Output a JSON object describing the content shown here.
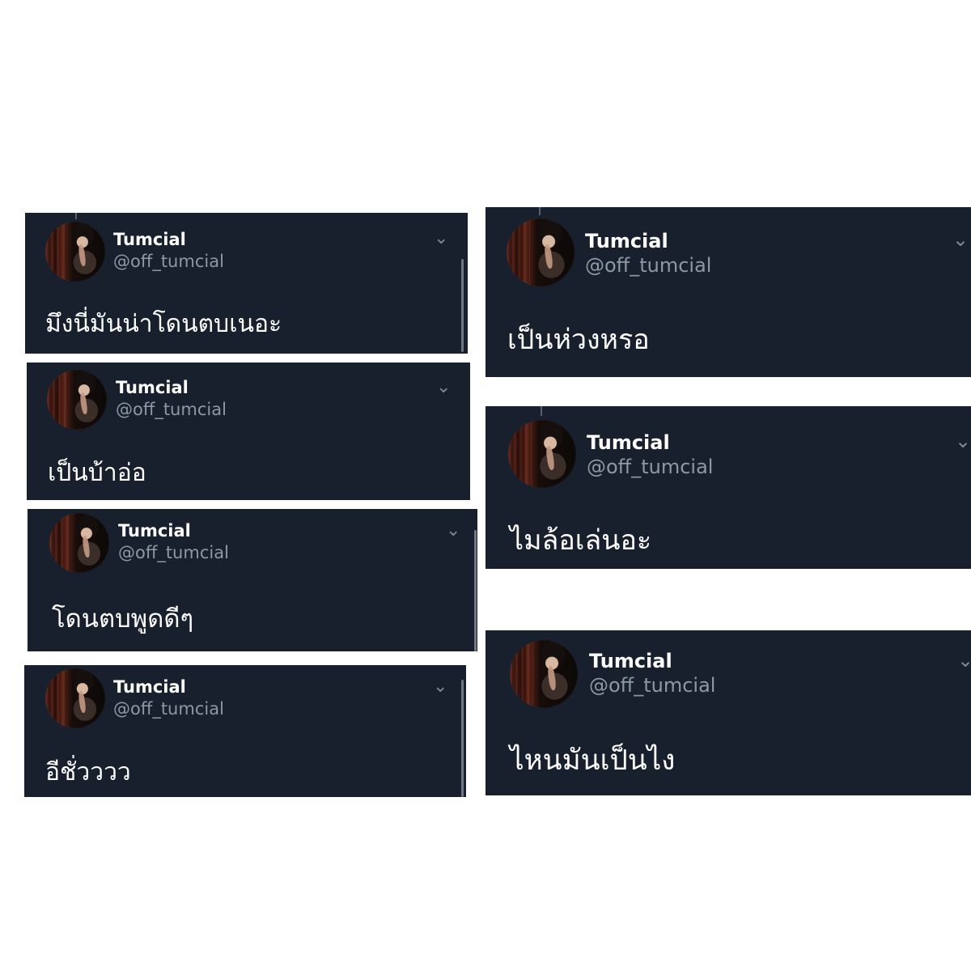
{
  "tweets": [
    {
      "name": "Tumcial",
      "handle": "@off_tumcial",
      "text": "มึงนี่มันน่าโดนตบเนอะ",
      "menu_icon": "chevron-down-icon"
    },
    {
      "name": "Tumcial",
      "handle": "@off_tumcial",
      "text": "เป็นบ้าอ่อ",
      "menu_icon": "chevron-down-icon"
    },
    {
      "name": "Tumcial",
      "handle": "@off_tumcial",
      "text": "โดนตบพูดดีๆ",
      "menu_icon": "chevron-down-icon"
    },
    {
      "name": "Tumcial",
      "handle": "@off_tumcial",
      "text": "อีชั่วววว",
      "menu_icon": "chevron-down-icon"
    },
    {
      "name": "Tumcial",
      "handle": "@off_tumcial",
      "text": "เป็นห่วงหรอ",
      "menu_icon": "chevron-down-icon"
    },
    {
      "name": "Tumcial",
      "handle": "@off_tumcial",
      "text": "ไมล้อเล่นอะ",
      "menu_icon": "chevron-down-icon"
    },
    {
      "name": "Tumcial",
      "handle": "@off_tumcial",
      "text": "ไหนมันเป็นไง",
      "menu_icon": "chevron-down-icon"
    }
  ],
  "colors": {
    "background": "#ffffff",
    "card": "#18202d",
    "name": "#ffffff",
    "handle": "#8d98a6",
    "text": "#ffffff",
    "menu": "#7b8794"
  }
}
